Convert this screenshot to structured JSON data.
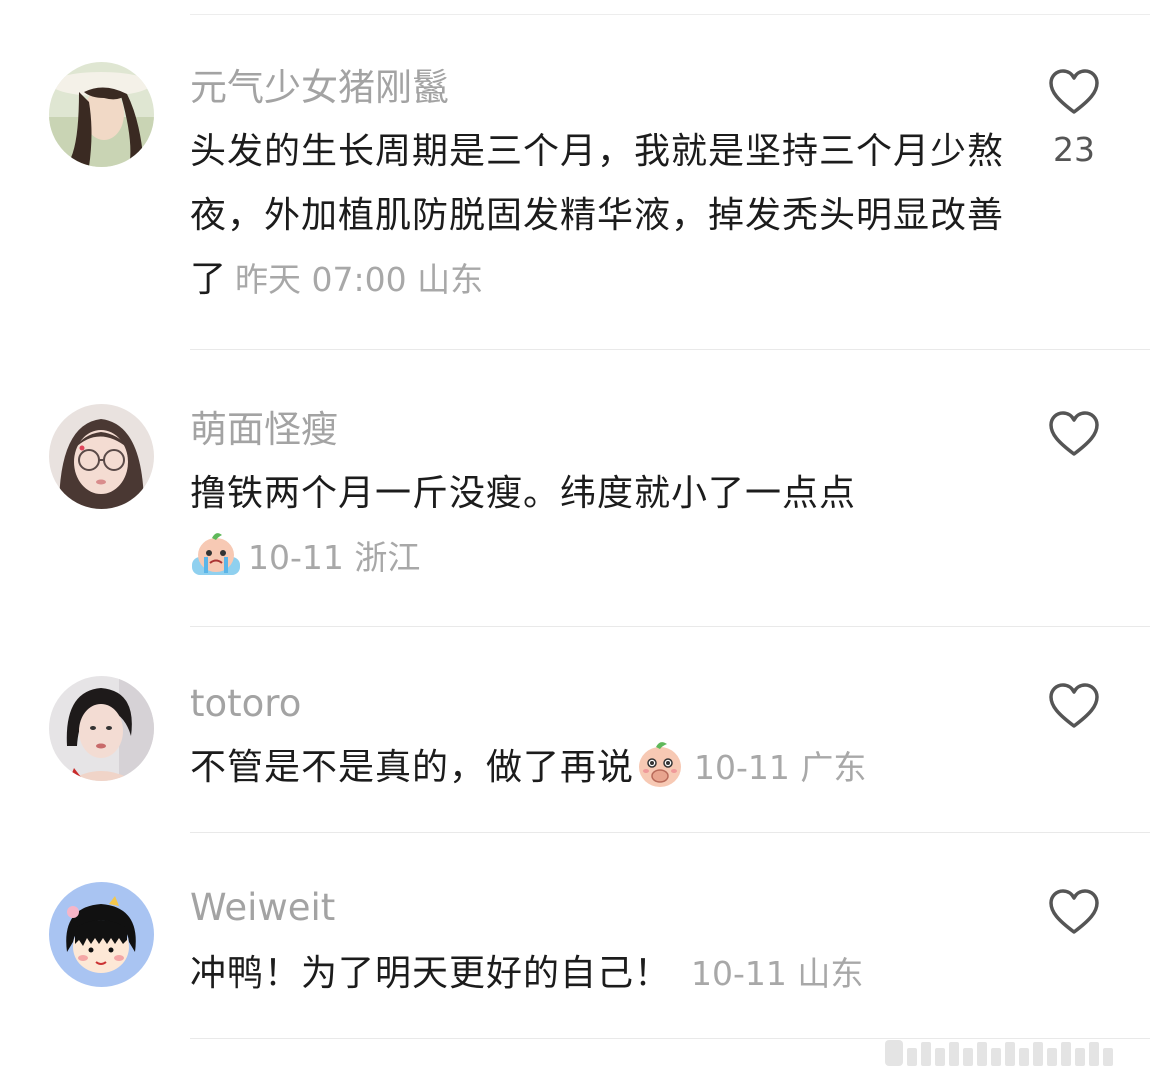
{
  "comments": [
    {
      "username": "元气少女猪刚鬣",
      "text": "头发的生长周期是三个月，我就是坚持三个月少熬夜，外加植肌防脱固发精华液，掉发秃头明显改善了",
      "time": "昨天 07:00",
      "location": "山东",
      "likes": "23",
      "avatar": "woman-straw-hat-avatar"
    },
    {
      "username": "萌面怪瘦",
      "text": "撸铁两个月一斤没瘦。纬度就小了一点点",
      "emoji": "crying-peach-emoji",
      "time": "10-11",
      "location": "浙江",
      "likes": "",
      "avatar": "girl-glasses-avatar"
    },
    {
      "username": "totoro",
      "text": "不管是不是真的，做了再说",
      "emoji": "covering-mouth-peach-emoji",
      "time": "10-11",
      "location": "广东",
      "likes": "",
      "avatar": "woman-short-hair-avatar"
    },
    {
      "username": "Weiweit",
      "text": "冲鸭！为了明天更好的自己！",
      "time": "10-11",
      "location": "山东",
      "likes": "",
      "avatar": "cartoon-girl-avatar"
    }
  ],
  "icons": {
    "like": "heart-outline-icon"
  },
  "colors": {
    "username": "#a3a3a3",
    "text": "#1c1c1c",
    "meta": "#a8a8a8",
    "divider": "#e9e9e9"
  }
}
